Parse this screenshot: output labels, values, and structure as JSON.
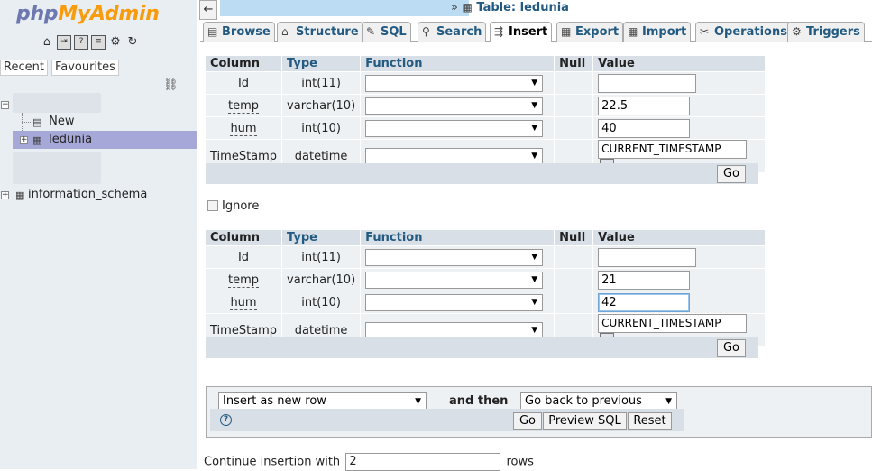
{
  "nav": {
    "logo_part1": "php",
    "logo_part2": "MyAdmin",
    "quick_icons": [
      "home-icon",
      "exit-icon",
      "docs-icon",
      "sql-docs-icon",
      "settings-icon",
      "reload-icon"
    ],
    "tabs": [
      "Recent",
      "Favourites"
    ],
    "tree": {
      "new_label": "New",
      "selected_db": "ledunia",
      "other_db": "information_schema"
    }
  },
  "breadcrumb": {
    "separator": "»",
    "table_label": "Table: ledunia"
  },
  "tabs": [
    {
      "label": "Browse",
      "icon": "browse-icon"
    },
    {
      "label": "Structure",
      "icon": "structure-icon"
    },
    {
      "label": "SQL",
      "icon": "sql-icon"
    },
    {
      "label": "Search",
      "icon": "search-icon"
    },
    {
      "label": "Insert",
      "icon": "insert-icon",
      "active": true
    },
    {
      "label": "Export",
      "icon": "export-icon"
    },
    {
      "label": "Import",
      "icon": "import-icon"
    },
    {
      "label": "Operations",
      "icon": "operations-icon"
    },
    {
      "label": "Triggers",
      "icon": "triggers-icon"
    }
  ],
  "headers": {
    "column": "Column",
    "type": "Type",
    "function": "Function",
    "null": "Null",
    "value": "Value"
  },
  "form1": {
    "rows": [
      {
        "column": "Id",
        "type": "int(11)",
        "value": ""
      },
      {
        "column": "temp",
        "type": "varchar(10)",
        "value": "22.5"
      },
      {
        "column": "hum",
        "type": "int(10)",
        "value": "40"
      },
      {
        "column": "TimeStamp",
        "type": "datetime",
        "value": "CURRENT_TIMESTAMP"
      }
    ],
    "go_label": "Go"
  },
  "ignore_label": "Ignore",
  "form2": {
    "rows": [
      {
        "column": "Id",
        "type": "int(11)",
        "value": ""
      },
      {
        "column": "temp",
        "type": "varchar(10)",
        "value": "21"
      },
      {
        "column": "hum",
        "type": "int(10)",
        "value": "42"
      },
      {
        "column": "TimeStamp",
        "type": "datetime",
        "value": "CURRENT_TIMESTAMP"
      }
    ],
    "go_label": "Go"
  },
  "footer": {
    "insert_mode": "Insert as new row",
    "and_then": "and then",
    "after_action": "Go back to previous page",
    "go_label": "Go",
    "preview_label": "Preview SQL",
    "reset_label": "Reset",
    "help_glyph": "?"
  },
  "continue": {
    "prefix": "Continue insertion with",
    "count": "2",
    "suffix": "rows"
  }
}
